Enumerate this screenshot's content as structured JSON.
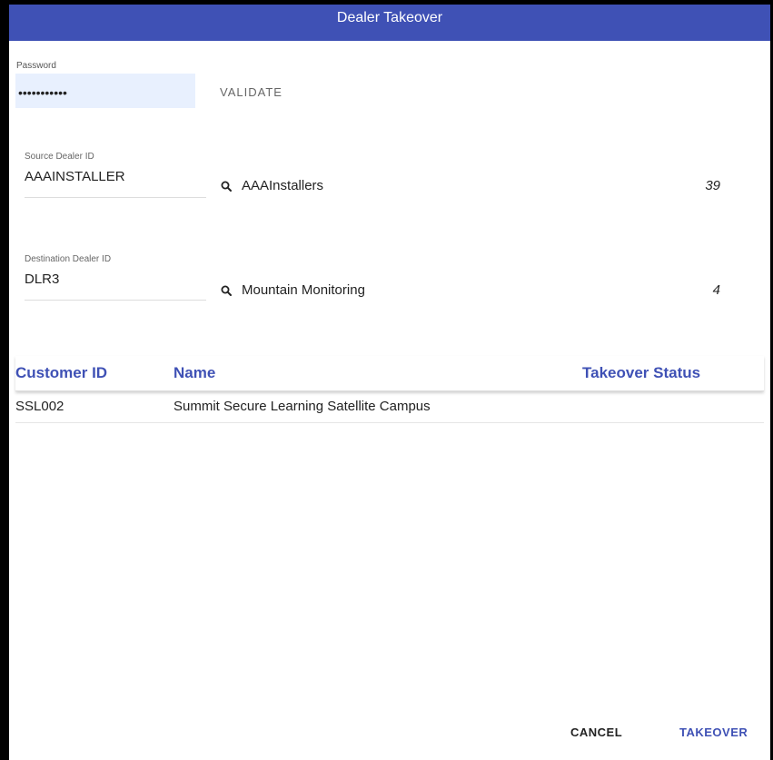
{
  "dialog": {
    "title": "Dealer Takeover"
  },
  "password": {
    "label": "Password",
    "value": "•••••••••••",
    "validate_label": "VALIDATE"
  },
  "source": {
    "label": "Source Dealer ID",
    "value": "AAAINSTALLER",
    "dealer_name": "AAAInstallers",
    "count": "39"
  },
  "destination": {
    "label": "Destination Dealer ID",
    "value": "DLR3",
    "dealer_name": "Mountain Monitoring",
    "count": "4"
  },
  "table": {
    "headers": {
      "customer_id": "Customer ID",
      "name": "Name",
      "status": "Takeover Status"
    },
    "rows": [
      {
        "customer_id": "SSL002",
        "name": "Summit Secure Learning Satellite Campus",
        "status": ""
      }
    ]
  },
  "actions": {
    "cancel_label": "CANCEL",
    "takeover_label": "TAKEOVER"
  },
  "colors": {
    "accent": "#3f51b5",
    "title_bar": "#3f51b5",
    "autofill_bg": "#e8f0fe"
  },
  "icons": {
    "lookup": "search-icon"
  }
}
